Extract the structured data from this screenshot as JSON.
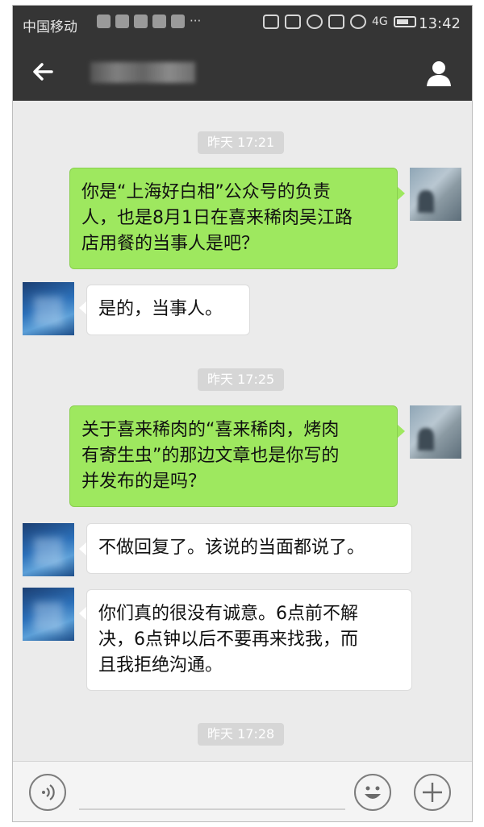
{
  "status_bar": {
    "carrier": "中国移动",
    "time": "13:42",
    "network_label": "4G"
  },
  "header": {
    "back_icon": "arrow-left-icon",
    "profile_icon": "person-icon"
  },
  "chat": {
    "timestamps": [
      "昨天 17:21",
      "昨天 17:25",
      "昨天 17:28"
    ],
    "messages": [
      {
        "from": "me",
        "lines": [
          "你是“上海好白相”公众号的负责",
          "人，也是8月1日在喜来稀肉吴江路",
          "店用餐的当事人是吧？"
        ]
      },
      {
        "from": "other",
        "lines": [
          "是的，当事人。"
        ]
      },
      {
        "from": "me",
        "lines": [
          "关于喜来稀肉的“喜来稀肉，烤肉",
          "有寄生虫”的那边文章也是你写的",
          "并发布的是吗？"
        ]
      },
      {
        "from": "other",
        "lines": [
          "不做回复了。该说的当面都说了。"
        ]
      },
      {
        "from": "other",
        "lines": [
          "你们真的很没有诚意。6点前不解",
          "决，6点钟以后不要再来找我，而",
          "且我拒绝沟通。"
        ]
      }
    ]
  },
  "input_bar": {
    "voice_icon": "voice-icon",
    "emoji_icon": "emoji-icon",
    "plus_icon": "plus-icon"
  },
  "colors": {
    "header_bg": "#353535",
    "chat_bg": "#ebebeb",
    "my_bubble": "#9ee85f",
    "other_bubble": "#ffffff"
  }
}
